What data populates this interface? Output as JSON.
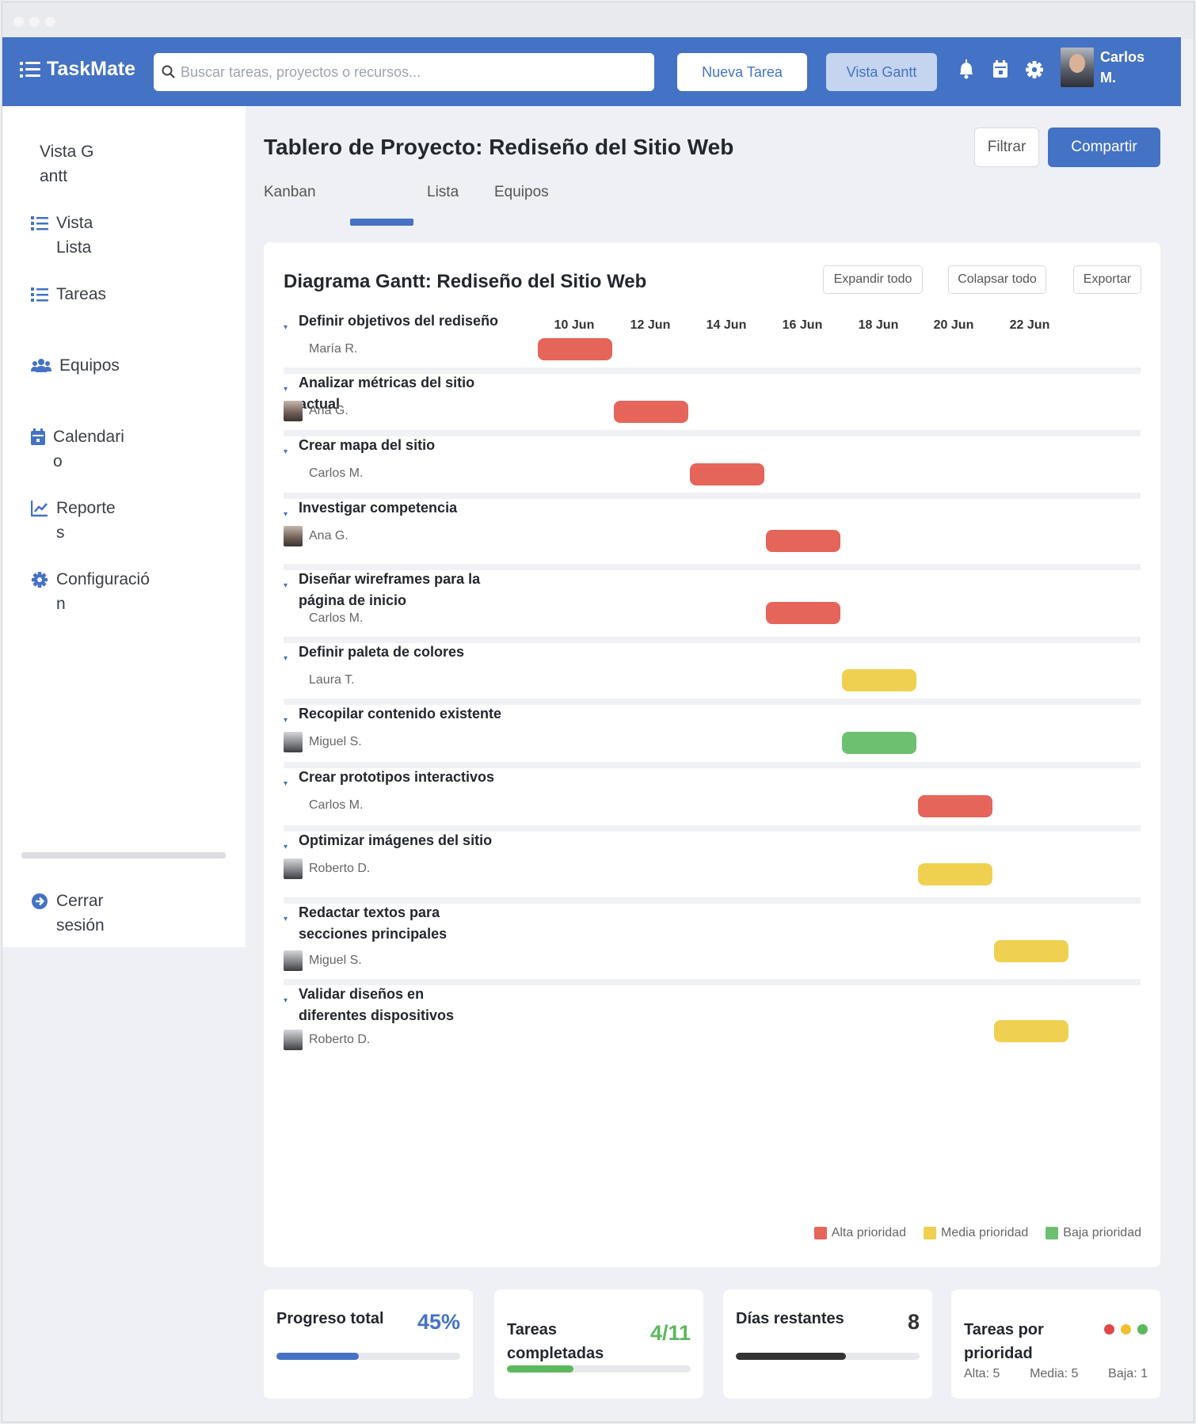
{
  "app": {
    "name": "TaskMate"
  },
  "header": {
    "search_placeholder": "Buscar tareas, proyectos o recursos...",
    "new_task_label": "Nueva Tarea",
    "gantt_view_label": "Vista Gantt",
    "user_name": "Carlos M."
  },
  "sidebar": {
    "items": [
      {
        "label": "Vista Gantt",
        "icon": "none"
      },
      {
        "label": "Vista Lista",
        "icon": "list-icon"
      },
      {
        "label": "Tareas",
        "icon": "list-icon"
      },
      {
        "label": "Equipos",
        "icon": "users-icon"
      },
      {
        "label": "Calendario",
        "icon": "calendar-icon"
      },
      {
        "label": "Reportes",
        "icon": "chart-icon"
      },
      {
        "label": "Configuración",
        "icon": "gear-icon"
      }
    ],
    "logout_label": "Cerrar sesión"
  },
  "page": {
    "title": "Tablero de Proyecto: Rediseño del Sitio Web",
    "filter_label": "Filtrar",
    "share_label": "Compartir",
    "tabs": [
      {
        "label": "Kanban"
      },
      {
        "label": "Lista"
      },
      {
        "label": "Equipos"
      }
    ]
  },
  "gantt": {
    "title": "Diagrama Gantt: Rediseño del Sitio Web",
    "expand_label": "Expandir todo",
    "collapse_label": "Colapsar todo",
    "export_label": "Exportar",
    "dates": [
      "10 Jun",
      "12 Jun",
      "14 Jun",
      "16 Jun",
      "18 Jun",
      "20 Jun",
      "22 Jun"
    ],
    "tasks": [
      {
        "name": "Definir objetivos del rediseño",
        "assignee": "María R.",
        "start": "10 Jun",
        "end": "12 Jun",
        "priority": "alta",
        "avatar": false
      },
      {
        "name": "Analizar métricas del sitio actual",
        "assignee": "Ana G.",
        "start": "12 Jun",
        "end": "14 Jun",
        "priority": "alta",
        "avatar": true
      },
      {
        "name": "Crear mapa del sitio",
        "assignee": "Carlos M.",
        "start": "14 Jun",
        "end": "16 Jun",
        "priority": "alta",
        "avatar": false
      },
      {
        "name": "Investigar competencia",
        "assignee": "Ana G.",
        "start": "16 Jun",
        "end": "18 Jun",
        "priority": "alta",
        "avatar": true
      },
      {
        "name": "Diseñar wireframes para la página de inicio",
        "assignee": "Carlos M.",
        "start": "16 Jun",
        "end": "18 Jun",
        "priority": "alta",
        "avatar": false
      },
      {
        "name": "Definir paleta de colores",
        "assignee": "Laura T.",
        "start": "18 Jun",
        "end": "20 Jun",
        "priority": "media",
        "avatar": false
      },
      {
        "name": "Recopilar contenido existente",
        "assignee": "Miguel S.",
        "start": "18 Jun",
        "end": "20 Jun",
        "priority": "baja",
        "avatar": true
      },
      {
        "name": "Crear prototipos interactivos",
        "assignee": "Carlos M.",
        "start": "20 Jun",
        "end": "22 Jun",
        "priority": "alta",
        "avatar": false
      },
      {
        "name": "Optimizar imágenes del sitio",
        "assignee": "Roberto D.",
        "start": "20 Jun",
        "end": "22 Jun",
        "priority": "media",
        "avatar": true
      },
      {
        "name": "Redactar textos para secciones principales",
        "assignee": "Miguel S.",
        "start": "22 Jun",
        "end": "24 Jun",
        "priority": "media",
        "avatar": true
      },
      {
        "name": "Validar diseños en diferentes dispositivos",
        "assignee": "Roberto D.",
        "start": "22 Jun",
        "end": "24 Jun",
        "priority": "media",
        "avatar": true
      }
    ],
    "legend": [
      {
        "label": "Alta prioridad",
        "color": "#e5655a"
      },
      {
        "label": "Media prioridad",
        "color": "#f0d050"
      },
      {
        "label": "Baja prioridad",
        "color": "#6cc070"
      }
    ]
  },
  "stats": {
    "progress": {
      "title": "Progreso total",
      "value": "45%",
      "fraction": 0.45,
      "color": "#4472c4"
    },
    "completed": {
      "title": "Tareas completadas",
      "value": "4/11",
      "fraction": 0.3636,
      "color": "#5cb85c"
    },
    "days": {
      "title": "Días restantes",
      "value": "8",
      "fraction": 0.6,
      "color": "#333333"
    },
    "priority": {
      "title": "Tareas por prioridad",
      "alta": "Alta: 5",
      "media": "Media: 5",
      "baja": "Baja: 1"
    }
  },
  "colors": {
    "accent": "#4472c4",
    "alta": "#e5655a",
    "media": "#f0d050",
    "baja": "#6cc070"
  }
}
